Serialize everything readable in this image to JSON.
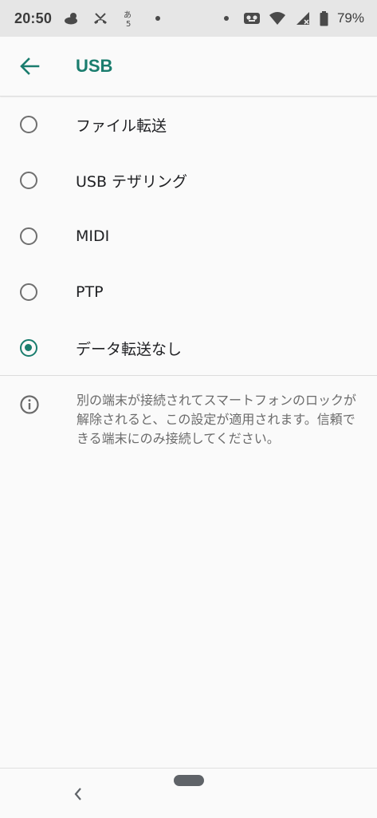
{
  "status_bar": {
    "time": "20:50",
    "battery_percent": "79%",
    "icons_left": [
      "weather-cloud-icon",
      "missed-call-icon",
      "ime-kana-icon",
      "dot-icon"
    ],
    "icons_right": [
      "dot-icon",
      "voicemail-icon",
      "wifi-icon",
      "signal-icon",
      "battery-icon"
    ]
  },
  "app_bar": {
    "title": "USB",
    "back_icon": "arrow-back-icon"
  },
  "options": [
    {
      "label": "ファイル転送",
      "selected": false
    },
    {
      "label": "USB テザリング",
      "selected": false
    },
    {
      "label": "MIDI",
      "selected": false
    },
    {
      "label": "PTP",
      "selected": false
    },
    {
      "label": "データ転送なし",
      "selected": true
    }
  ],
  "info": {
    "icon": "info-icon",
    "text": "別の端末が接続されてスマートフォンのロックが解除されると、この設定が適用されます。信頼できる端末にのみ接続してください。"
  },
  "colors": {
    "accent": "#1a7d6e",
    "status_bar_bg": "#e6e6e6",
    "background": "#fafafa"
  }
}
